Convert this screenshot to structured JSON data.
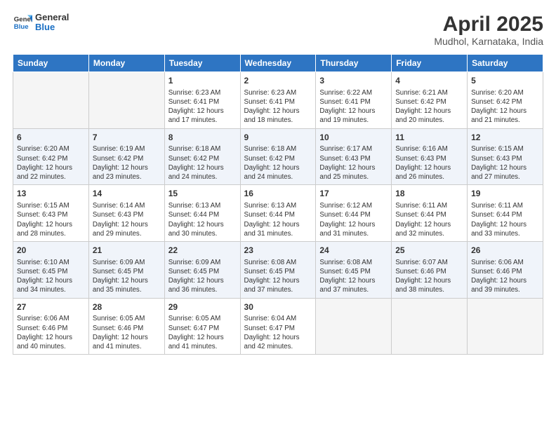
{
  "header": {
    "logo_line1": "General",
    "logo_line2": "Blue",
    "title": "April 2025",
    "subtitle": "Mudhol, Karnataka, India"
  },
  "days_of_week": [
    "Sunday",
    "Monday",
    "Tuesday",
    "Wednesday",
    "Thursday",
    "Friday",
    "Saturday"
  ],
  "weeks": [
    [
      {
        "day": "",
        "info": ""
      },
      {
        "day": "",
        "info": ""
      },
      {
        "day": "1",
        "info": "Sunrise: 6:23 AM\nSunset: 6:41 PM\nDaylight: 12 hours\nand 17 minutes."
      },
      {
        "day": "2",
        "info": "Sunrise: 6:23 AM\nSunset: 6:41 PM\nDaylight: 12 hours\nand 18 minutes."
      },
      {
        "day": "3",
        "info": "Sunrise: 6:22 AM\nSunset: 6:41 PM\nDaylight: 12 hours\nand 19 minutes."
      },
      {
        "day": "4",
        "info": "Sunrise: 6:21 AM\nSunset: 6:42 PM\nDaylight: 12 hours\nand 20 minutes."
      },
      {
        "day": "5",
        "info": "Sunrise: 6:20 AM\nSunset: 6:42 PM\nDaylight: 12 hours\nand 21 minutes."
      }
    ],
    [
      {
        "day": "6",
        "info": "Sunrise: 6:20 AM\nSunset: 6:42 PM\nDaylight: 12 hours\nand 22 minutes."
      },
      {
        "day": "7",
        "info": "Sunrise: 6:19 AM\nSunset: 6:42 PM\nDaylight: 12 hours\nand 23 minutes."
      },
      {
        "day": "8",
        "info": "Sunrise: 6:18 AM\nSunset: 6:42 PM\nDaylight: 12 hours\nand 24 minutes."
      },
      {
        "day": "9",
        "info": "Sunrise: 6:18 AM\nSunset: 6:42 PM\nDaylight: 12 hours\nand 24 minutes."
      },
      {
        "day": "10",
        "info": "Sunrise: 6:17 AM\nSunset: 6:43 PM\nDaylight: 12 hours\nand 25 minutes."
      },
      {
        "day": "11",
        "info": "Sunrise: 6:16 AM\nSunset: 6:43 PM\nDaylight: 12 hours\nand 26 minutes."
      },
      {
        "day": "12",
        "info": "Sunrise: 6:15 AM\nSunset: 6:43 PM\nDaylight: 12 hours\nand 27 minutes."
      }
    ],
    [
      {
        "day": "13",
        "info": "Sunrise: 6:15 AM\nSunset: 6:43 PM\nDaylight: 12 hours\nand 28 minutes."
      },
      {
        "day": "14",
        "info": "Sunrise: 6:14 AM\nSunset: 6:43 PM\nDaylight: 12 hours\nand 29 minutes."
      },
      {
        "day": "15",
        "info": "Sunrise: 6:13 AM\nSunset: 6:44 PM\nDaylight: 12 hours\nand 30 minutes."
      },
      {
        "day": "16",
        "info": "Sunrise: 6:13 AM\nSunset: 6:44 PM\nDaylight: 12 hours\nand 31 minutes."
      },
      {
        "day": "17",
        "info": "Sunrise: 6:12 AM\nSunset: 6:44 PM\nDaylight: 12 hours\nand 31 minutes."
      },
      {
        "day": "18",
        "info": "Sunrise: 6:11 AM\nSunset: 6:44 PM\nDaylight: 12 hours\nand 32 minutes."
      },
      {
        "day": "19",
        "info": "Sunrise: 6:11 AM\nSunset: 6:44 PM\nDaylight: 12 hours\nand 33 minutes."
      }
    ],
    [
      {
        "day": "20",
        "info": "Sunrise: 6:10 AM\nSunset: 6:45 PM\nDaylight: 12 hours\nand 34 minutes."
      },
      {
        "day": "21",
        "info": "Sunrise: 6:09 AM\nSunset: 6:45 PM\nDaylight: 12 hours\nand 35 minutes."
      },
      {
        "day": "22",
        "info": "Sunrise: 6:09 AM\nSunset: 6:45 PM\nDaylight: 12 hours\nand 36 minutes."
      },
      {
        "day": "23",
        "info": "Sunrise: 6:08 AM\nSunset: 6:45 PM\nDaylight: 12 hours\nand 37 minutes."
      },
      {
        "day": "24",
        "info": "Sunrise: 6:08 AM\nSunset: 6:45 PM\nDaylight: 12 hours\nand 37 minutes."
      },
      {
        "day": "25",
        "info": "Sunrise: 6:07 AM\nSunset: 6:46 PM\nDaylight: 12 hours\nand 38 minutes."
      },
      {
        "day": "26",
        "info": "Sunrise: 6:06 AM\nSunset: 6:46 PM\nDaylight: 12 hours\nand 39 minutes."
      }
    ],
    [
      {
        "day": "27",
        "info": "Sunrise: 6:06 AM\nSunset: 6:46 PM\nDaylight: 12 hours\nand 40 minutes."
      },
      {
        "day": "28",
        "info": "Sunrise: 6:05 AM\nSunset: 6:46 PM\nDaylight: 12 hours\nand 41 minutes."
      },
      {
        "day": "29",
        "info": "Sunrise: 6:05 AM\nSunset: 6:47 PM\nDaylight: 12 hours\nand 41 minutes."
      },
      {
        "day": "30",
        "info": "Sunrise: 6:04 AM\nSunset: 6:47 PM\nDaylight: 12 hours\nand 42 minutes."
      },
      {
        "day": "",
        "info": ""
      },
      {
        "day": "",
        "info": ""
      },
      {
        "day": "",
        "info": ""
      }
    ]
  ]
}
